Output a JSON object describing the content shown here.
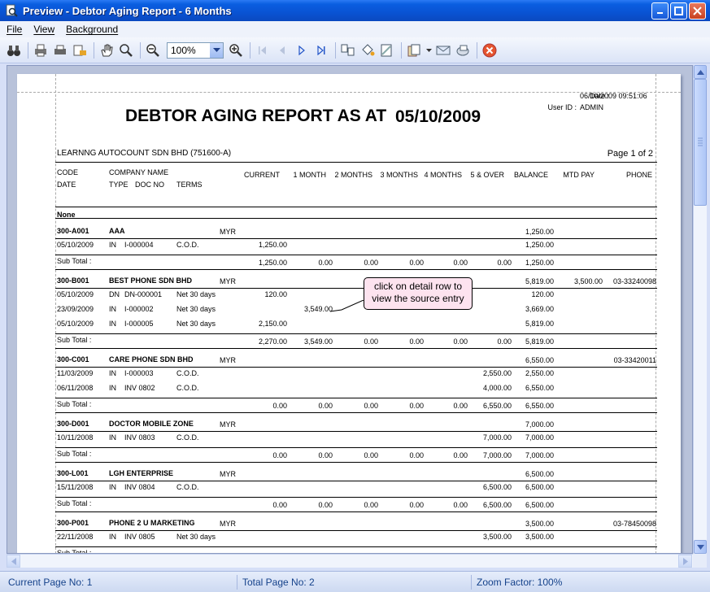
{
  "window": {
    "title": "Preview - Debtor Aging Report - 6 Months"
  },
  "menu": [
    "File",
    "View",
    "Background"
  ],
  "toolbar": {
    "zoom_value": "100%"
  },
  "report": {
    "date_label": "Date :",
    "date_value": "06/10/2009 09:51:06",
    "user_label": "User ID :",
    "user_value": "ADMIN",
    "title": "DEBTOR AGING REPORT AS AT",
    "as_at": "05/10/2009",
    "company": "LEARNNG AUTOCOUNT SDN BHD (751600-A)",
    "page_info": "Page 1 of 2",
    "headers": {
      "code": "CODE",
      "company_name": "COMPANY NAME",
      "date": "DATE",
      "type": "TYPE",
      "doc_no": "DOC NO",
      "terms": "TERMS",
      "current": "CURRENT",
      "m1": "1 MONTH",
      "m2": "2 MONTHS",
      "m3": "3 MONTHS",
      "m4": "4 MONTHS",
      "m5": "5 & OVER",
      "balance": "BALANCE",
      "mtd_pay": "MTD PAY",
      "phone": "PHONE"
    },
    "group_label": "None",
    "subtotal_label": "Sub Total :",
    "debtors": [
      {
        "code": "300-A001",
        "name": "AAA",
        "currency": "MYR",
        "balance": "1,250.00",
        "mtd": "",
        "phone": "",
        "rows": [
          {
            "date": "05/10/2009",
            "type": "IN",
            "doc": "I-000004",
            "terms": "C.O.D.",
            "current": "1,250.00",
            "m1": "",
            "m5": "",
            "balance": "1,250.00"
          }
        ],
        "sub": {
          "current": "1,250.00",
          "m1": "0.00",
          "m2": "0.00",
          "m3": "0.00",
          "m4": "0.00",
          "m5": "0.00",
          "balance": "1,250.00"
        }
      },
      {
        "code": "300-B001",
        "name": "BEST PHONE SDN BHD",
        "currency": "MYR",
        "balance": "5,819.00",
        "mtd": "3,500.00",
        "phone": "03-33240098",
        "rows": [
          {
            "date": "05/10/2009",
            "type": "DN",
            "doc": "DN-000001",
            "terms": "Net 30 days",
            "current": "120.00",
            "m1": "",
            "m5": "",
            "balance": "120.00"
          },
          {
            "date": "23/09/2009",
            "type": "IN",
            "doc": "I-000002",
            "terms": "Net 30 days",
            "current": "",
            "m1": "3,549.00",
            "m5": "",
            "balance": "3,669.00"
          },
          {
            "date": "05/10/2009",
            "type": "IN",
            "doc": "I-000005",
            "terms": "Net 30 days",
            "current": "2,150.00",
            "m1": "",
            "m5": "",
            "balance": "5,819.00"
          }
        ],
        "sub": {
          "current": "2,270.00",
          "m1": "3,549.00",
          "m2": "0.00",
          "m3": "0.00",
          "m4": "0.00",
          "m5": "0.00",
          "balance": "5,819.00"
        }
      },
      {
        "code": "300-C001",
        "name": "CARE PHONE SDN BHD",
        "currency": "MYR",
        "balance": "6,550.00",
        "mtd": "",
        "phone": "03-33420011",
        "rows": [
          {
            "date": "11/03/2009",
            "type": "IN",
            "doc": "I-000003",
            "terms": "C.O.D.",
            "current": "",
            "m1": "",
            "m5": "2,550.00",
            "balance": "2,550.00"
          },
          {
            "date": "06/11/2008",
            "type": "IN",
            "doc": "INV 0802",
            "terms": "C.O.D.",
            "current": "",
            "m1": "",
            "m5": "4,000.00",
            "balance": "6,550.00"
          }
        ],
        "sub": {
          "current": "0.00",
          "m1": "0.00",
          "m2": "0.00",
          "m3": "0.00",
          "m4": "0.00",
          "m5": "6,550.00",
          "balance": "6,550.00"
        }
      },
      {
        "code": "300-D001",
        "name": "DOCTOR MOBILE ZONE",
        "currency": "MYR",
        "balance": "7,000.00",
        "mtd": "",
        "phone": "",
        "rows": [
          {
            "date": "10/11/2008",
            "type": "IN",
            "doc": "INV 0803",
            "terms": "C.O.D.",
            "current": "",
            "m1": "",
            "m5": "7,000.00",
            "balance": "7,000.00"
          }
        ],
        "sub": {
          "current": "0.00",
          "m1": "0.00",
          "m2": "0.00",
          "m3": "0.00",
          "m4": "0.00",
          "m5": "7,000.00",
          "balance": "7,000.00"
        }
      },
      {
        "code": "300-L001",
        "name": "LGH ENTERPRISE",
        "currency": "MYR",
        "balance": "6,500.00",
        "mtd": "",
        "phone": "",
        "rows": [
          {
            "date": "15/11/2008",
            "type": "IN",
            "doc": "INV 0804",
            "terms": "C.O.D.",
            "current": "",
            "m1": "",
            "m5": "6,500.00",
            "balance": "6,500.00"
          }
        ],
        "sub": {
          "current": "0.00",
          "m1": "0.00",
          "m2": "0.00",
          "m3": "0.00",
          "m4": "0.00",
          "m5": "6,500.00",
          "balance": "6,500.00"
        }
      },
      {
        "code": "300-P001",
        "name": "PHONE 2 U MARKETING",
        "currency": "MYR",
        "balance": "3,500.00",
        "mtd": "",
        "phone": "03-78450098",
        "rows": [
          {
            "date": "22/11/2008",
            "type": "IN",
            "doc": "INV 0805",
            "terms": "Net 30 days",
            "current": "",
            "m1": "",
            "m5": "3,500.00",
            "balance": "3,500.00"
          }
        ],
        "sub": null
      }
    ],
    "tooltip": "click on detail row to view the source entry"
  },
  "status": {
    "current_page": "Current Page No: 1",
    "total_page": "Total Page No: 2",
    "zoom": "Zoom Factor: 100%"
  }
}
